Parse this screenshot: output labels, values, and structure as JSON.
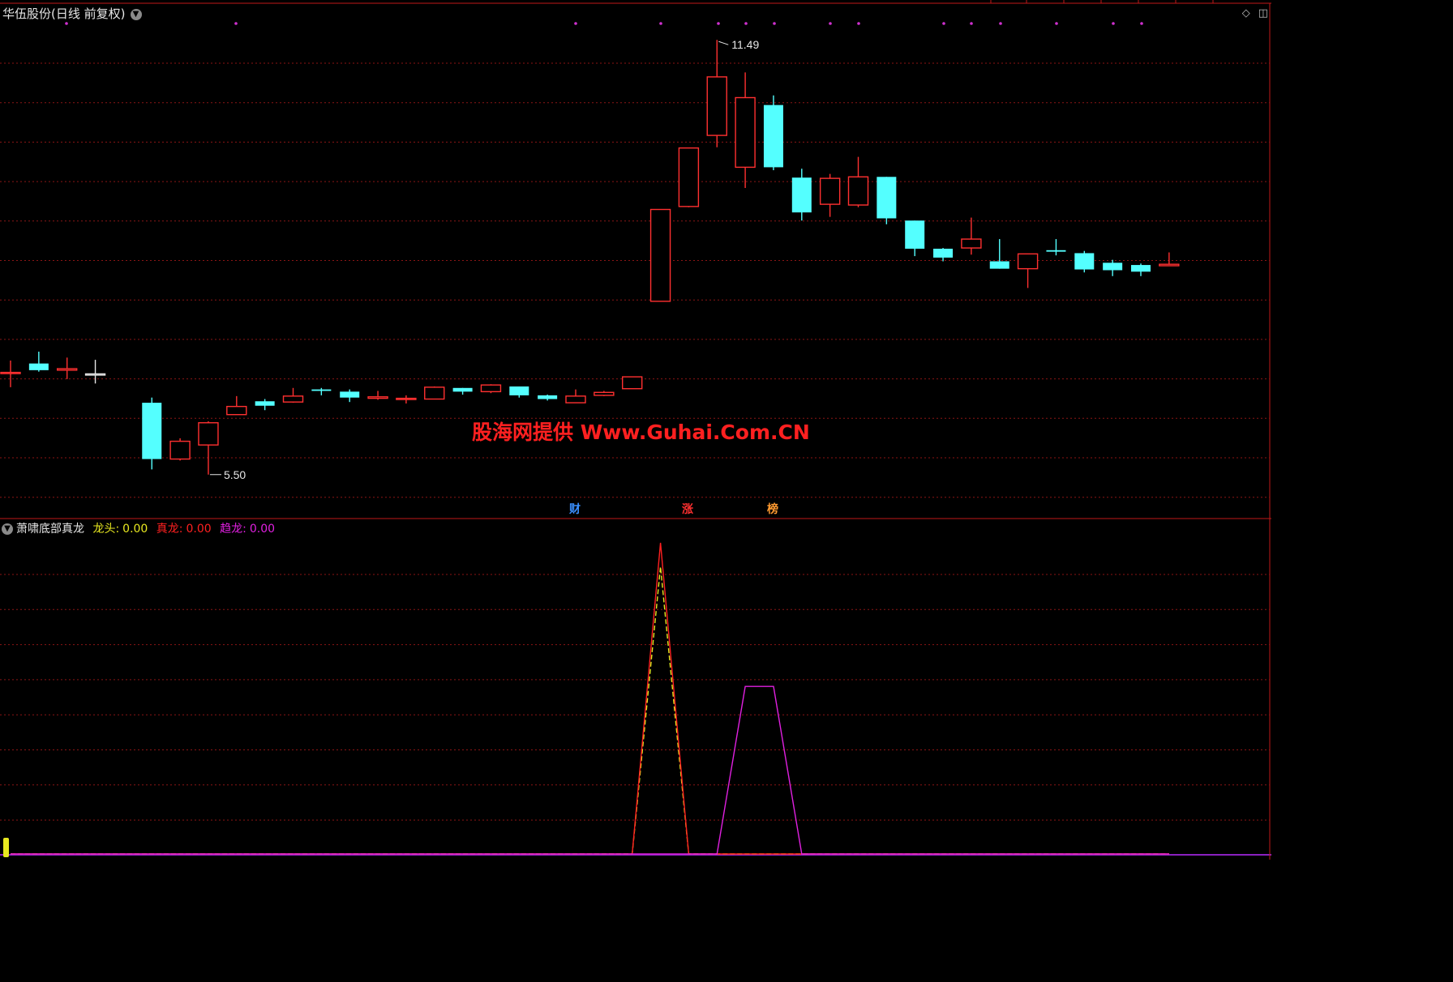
{
  "header": {
    "stock_name": "华伍股份",
    "period_label": "(日线 前复权)"
  },
  "indicator": {
    "name": "萧啸底部真龙",
    "items": [
      {
        "label": "龙头:",
        "value": "0.00",
        "color": "#e8e820"
      },
      {
        "label": "真龙:",
        "value": "0.00",
        "color": "#ff2020"
      },
      {
        "label": "趋龙:",
        "value": "0.00",
        "color": "#e020e0"
      }
    ]
  },
  "watermark": "股海网提供 Www.Guhai.Com.CN",
  "event_markers": [
    {
      "text": "财",
      "color": "#3a8fff"
    },
    {
      "text": "涨",
      "color": "#ff3030"
    },
    {
      "text": "榜",
      "color": "#ff9a30"
    }
  ],
  "colors": {
    "up": "#ff3030",
    "down": "#54ffff",
    "grid": "#8b1515",
    "dragon_head": "#e8e820",
    "true_dragon": "#ff2020",
    "trend_dragon": "#e020e0"
  },
  "chart_data": [
    {
      "type": "candlestick",
      "annotations": {
        "high_label": "11.49",
        "low_label": "5.50"
      },
      "ylim": [
        5.3,
        11.7
      ],
      "grid": true,
      "candles": [
        {
          "open": 7.0,
          "close": 7.0,
          "high": 7.16,
          "low": 6.8
        },
        {
          "open": 7.12,
          "close": 7.03,
          "high": 7.28,
          "low": 7.01
        },
        {
          "open": 7.03,
          "close": 7.05,
          "high": 7.2,
          "low": 6.91
        },
        {
          "open": 6.98,
          "close": 6.98,
          "high": 7.17,
          "low": 6.85
        },
        null,
        {
          "open": 6.59,
          "close": 5.83,
          "high": 6.66,
          "low": 5.69
        },
        {
          "open": 5.83,
          "close": 6.07,
          "high": 6.11,
          "low": 5.81
        },
        {
          "open": 6.02,
          "close": 6.32,
          "high": 6.34,
          "low": 5.62
        },
        {
          "open": 6.43,
          "close": 6.54,
          "high": 6.68,
          "low": 6.43
        },
        {
          "open": 6.61,
          "close": 6.55,
          "high": 6.64,
          "low": 6.49
        },
        {
          "open": 6.6,
          "close": 6.68,
          "high": 6.79,
          "low": 6.59
        },
        {
          "open": 6.77,
          "close": 6.75,
          "high": 6.79,
          "low": 6.69
        },
        {
          "open": 6.74,
          "close": 6.66,
          "high": 6.77,
          "low": 6.6
        },
        {
          "open": 6.65,
          "close": 6.67,
          "high": 6.75,
          "low": 6.63
        },
        {
          "open": 6.64,
          "close": 6.65,
          "high": 6.69,
          "low": 6.58
        },
        {
          "open": 6.64,
          "close": 6.8,
          "high": 6.81,
          "low": 6.64
        },
        {
          "open": 6.79,
          "close": 6.74,
          "high": 6.79,
          "low": 6.7
        },
        {
          "open": 6.74,
          "close": 6.83,
          "high": 6.84,
          "low": 6.72
        },
        {
          "open": 6.81,
          "close": 6.69,
          "high": 6.81,
          "low": 6.66
        },
        {
          "open": 6.69,
          "close": 6.64,
          "high": 6.7,
          "low": 6.62
        },
        {
          "open": 6.59,
          "close": 6.68,
          "high": 6.77,
          "low": 6.59
        },
        {
          "open": 6.69,
          "close": 6.73,
          "high": 6.75,
          "low": 6.68
        },
        {
          "open": 6.78,
          "close": 6.94,
          "high": 6.94,
          "low": 6.78
        },
        {
          "open": 7.96,
          "close": 9.2,
          "high": 9.2,
          "low": 7.96
        },
        {
          "open": 9.24,
          "close": 10.03,
          "high": 10.03,
          "low": 9.23
        },
        {
          "open": 10.2,
          "close": 10.99,
          "high": 11.49,
          "low": 10.04
        },
        {
          "open": 9.77,
          "close": 10.71,
          "high": 11.05,
          "low": 9.49
        },
        {
          "open": 10.61,
          "close": 9.77,
          "high": 10.74,
          "low": 9.73
        },
        {
          "open": 9.63,
          "close": 9.16,
          "high": 9.75,
          "low": 9.05
        },
        {
          "open": 9.27,
          "close": 9.62,
          "high": 9.68,
          "low": 9.1
        },
        {
          "open": 9.26,
          "close": 9.64,
          "high": 9.91,
          "low": 9.23
        },
        {
          "open": 9.64,
          "close": 9.08,
          "high": 9.64,
          "low": 9.0
        },
        {
          "open": 9.05,
          "close": 8.67,
          "high": 9.05,
          "low": 8.57
        },
        {
          "open": 8.67,
          "close": 8.55,
          "high": 8.68,
          "low": 8.5
        },
        {
          "open": 8.68,
          "close": 8.8,
          "high": 9.09,
          "low": 8.59
        },
        {
          "open": 8.5,
          "close": 8.4,
          "high": 8.8,
          "low": 8.4
        },
        {
          "open": 8.4,
          "close": 8.6,
          "high": 8.6,
          "low": 8.14
        },
        {
          "open": 8.65,
          "close": 8.63,
          "high": 8.8,
          "low": 8.58
        },
        {
          "open": 8.61,
          "close": 8.39,
          "high": 8.64,
          "low": 8.35
        },
        {
          "open": 8.48,
          "close": 8.38,
          "high": 8.52,
          "low": 8.3
        },
        {
          "open": 8.45,
          "close": 8.36,
          "high": 8.47,
          "low": 8.3
        },
        {
          "open": 8.44,
          "close": 8.46,
          "high": 8.62,
          "low": 8.44
        }
      ]
    },
    {
      "type": "line",
      "title": "萧啸底部真龙",
      "ylim": [
        0,
        1.3
      ],
      "series": [
        {
          "name": "龙头",
          "color": "#e8e820",
          "values": [
            0,
            0,
            0,
            0,
            0,
            0,
            0,
            0,
            0,
            0,
            0,
            0,
            0,
            0,
            0,
            0,
            0,
            0,
            0,
            0,
            0,
            0,
            0,
            1.2,
            0,
            0,
            0,
            0,
            0,
            0,
            0,
            0,
            0,
            0,
            0,
            0,
            0,
            0,
            0,
            0,
            0,
            0
          ]
        },
        {
          "name": "真龙",
          "color": "#ff2020",
          "values": [
            0,
            0,
            0,
            0,
            0,
            0,
            0,
            0,
            0,
            0,
            0,
            0,
            0,
            0,
            0,
            0,
            0,
            0,
            0,
            0,
            0,
            0,
            0,
            1.3,
            0,
            0,
            0,
            0,
            0,
            0,
            0,
            0,
            0,
            0,
            0,
            0,
            0,
            0,
            0,
            0,
            0,
            0
          ]
        },
        {
          "name": "趋龙",
          "color": "#e020e0",
          "values": [
            0,
            0,
            0,
            0,
            0,
            0,
            0,
            0,
            0,
            0,
            0,
            0,
            0,
            0,
            0,
            0,
            0,
            0,
            0,
            0,
            0,
            0,
            0,
            0,
            0,
            0,
            0.7,
            0.7,
            0,
            0,
            0,
            0,
            0,
            0,
            0,
            0,
            0,
            0,
            0,
            0,
            0,
            0
          ]
        }
      ]
    }
  ]
}
